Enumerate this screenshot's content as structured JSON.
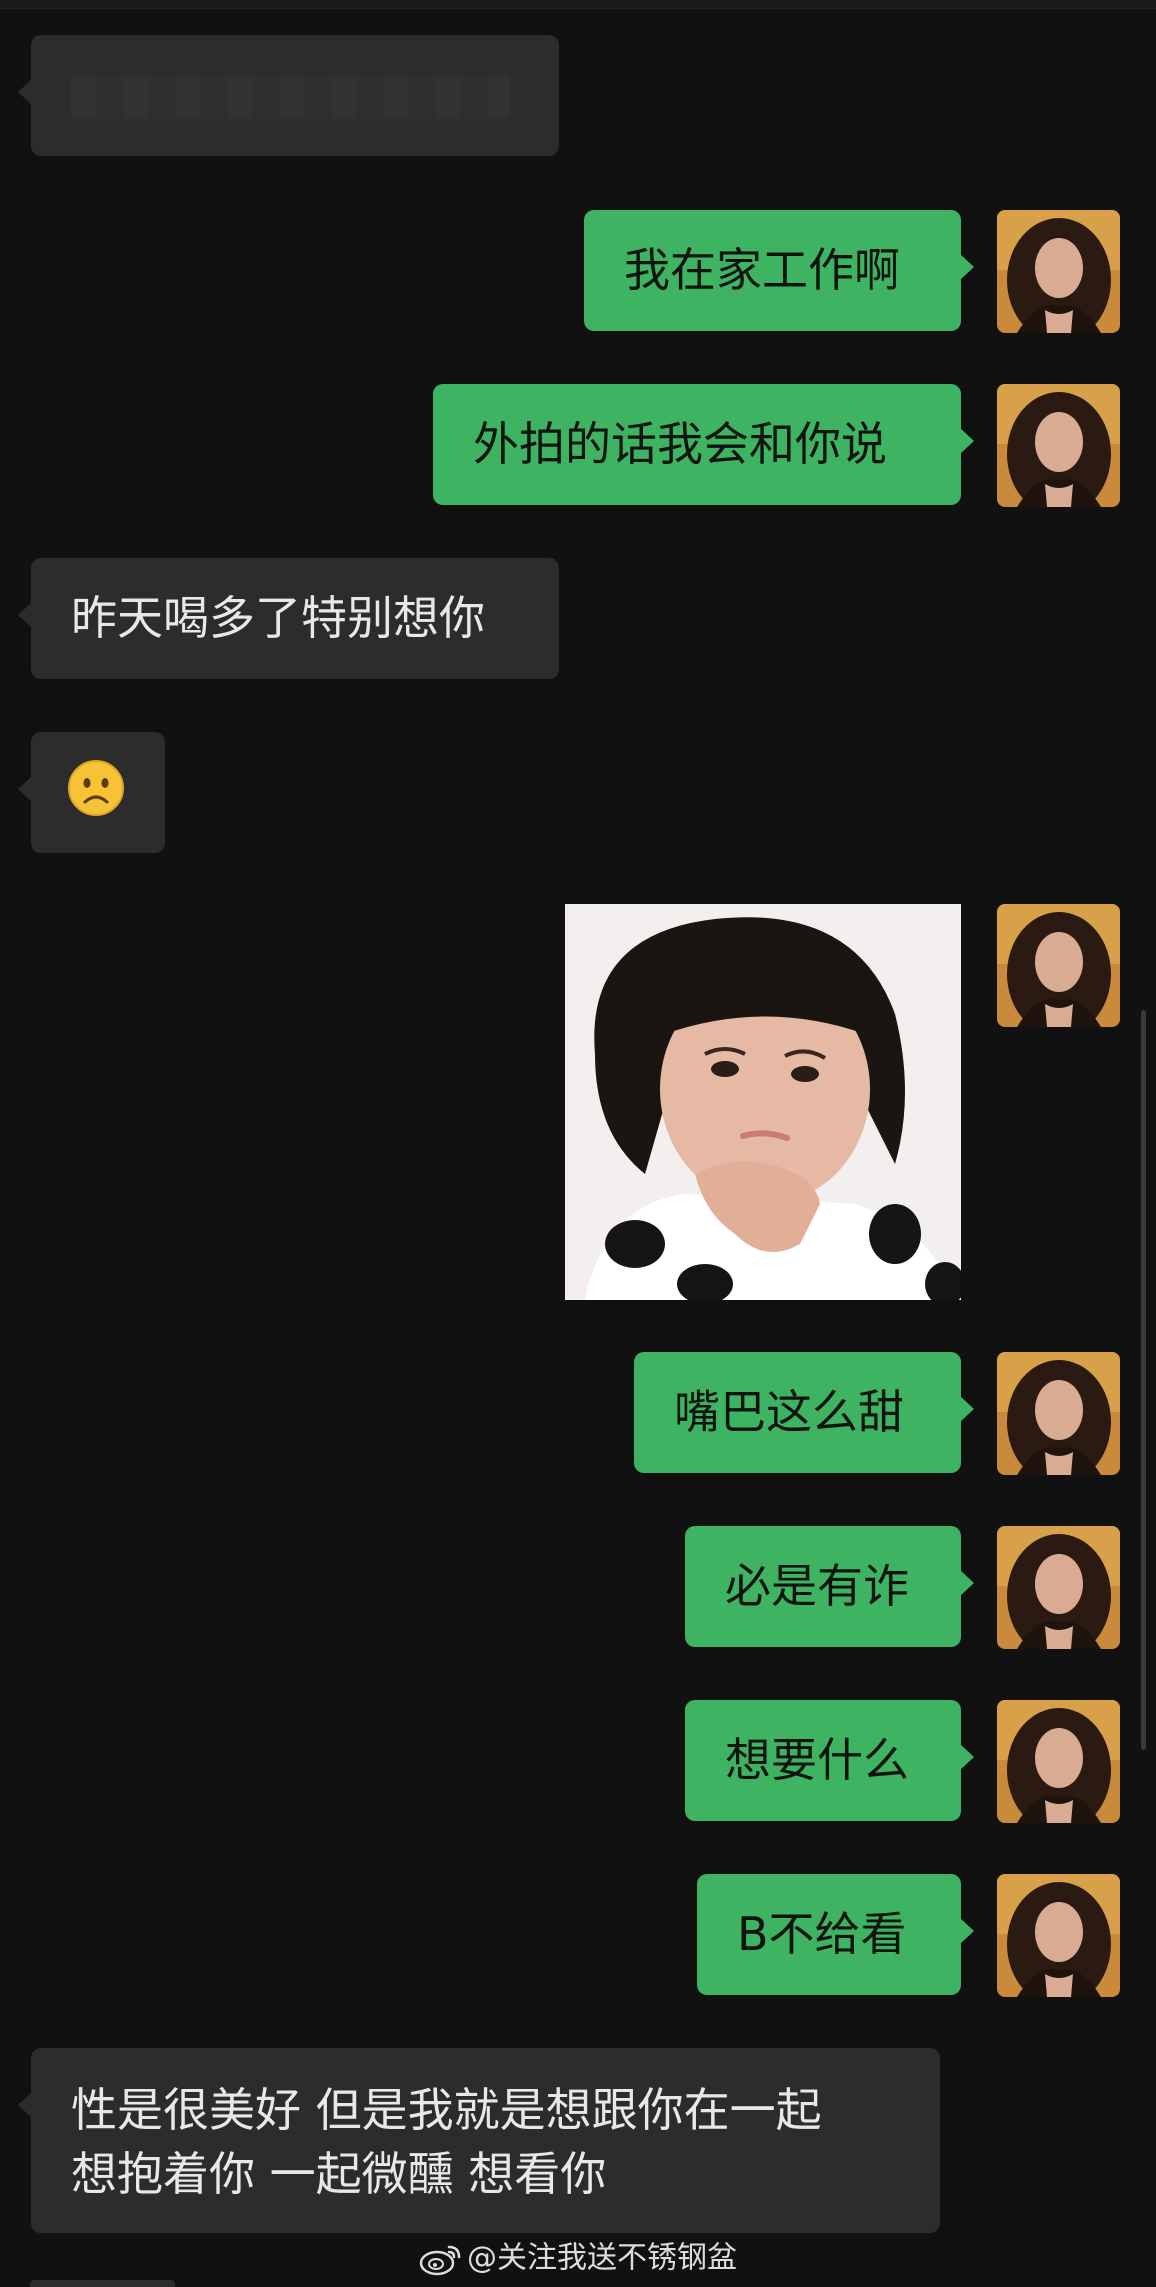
{
  "messages": [
    {
      "side": "in",
      "text": "",
      "redacted": true
    },
    {
      "side": "out",
      "text": "我在家工作啊"
    },
    {
      "side": "out",
      "text": "外拍的话我会和你说"
    },
    {
      "side": "in",
      "text": "昨天喝多了特别想你"
    },
    {
      "side": "in",
      "emoji": "frowning-face"
    },
    {
      "side": "out",
      "sticker": "child-thinking-sticker"
    },
    {
      "side": "out",
      "text": "嘴巴这么甜"
    },
    {
      "side": "out",
      "text": "必是有诈"
    },
    {
      "side": "out",
      "text": "想要什么"
    },
    {
      "side": "out",
      "text": "B不给看"
    },
    {
      "side": "in",
      "lines": [
        "性是很美好 但是我就是想跟你在一起",
        "想抱着你 一起微醺 想看你"
      ]
    }
  ],
  "watermark": {
    "text": "@关注我送不锈钢盆",
    "icon": "weibo-icon"
  },
  "colors": {
    "background": "#111111",
    "incoming_bubble": "#2c2c2c",
    "outgoing_bubble": "#3eb463"
  }
}
